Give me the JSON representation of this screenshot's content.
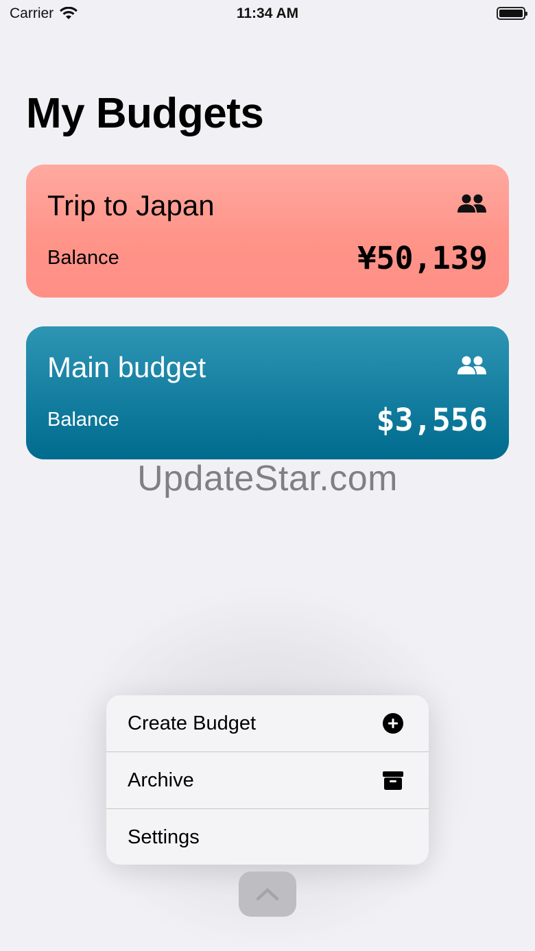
{
  "status_bar": {
    "carrier": "Carrier",
    "time": "11:34 AM"
  },
  "page": {
    "title": "My Budgets"
  },
  "budgets": [
    {
      "name": "Trip to Japan",
      "balance_label": "Balance",
      "balance": "¥50,139",
      "icon": "people-icon",
      "color": "#ff9a90"
    },
    {
      "name": "Main budget",
      "balance_label": "Balance",
      "balance": "$3,556",
      "icon": "people-icon",
      "color": "#1a82a4"
    }
  ],
  "watermark": "UpdateStar.com",
  "menu": {
    "items": [
      {
        "label": "Create Budget",
        "icon": "plus-circle-icon"
      },
      {
        "label": "Archive",
        "icon": "archive-box-icon"
      },
      {
        "label": "Settings",
        "icon": ""
      }
    ]
  },
  "fab": {
    "icon": "chevron-up-icon"
  }
}
